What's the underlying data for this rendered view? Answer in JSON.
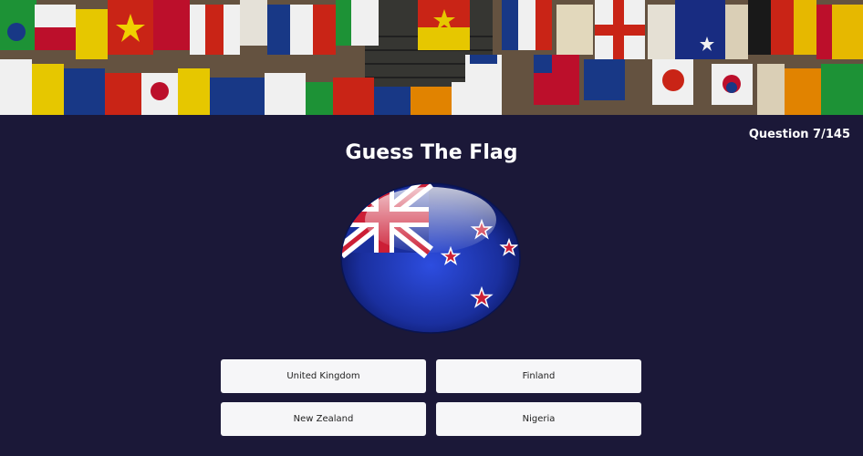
{
  "header": {
    "banner_icon": "world-flags-banner-image",
    "question_counter": "Question 7/145"
  },
  "main": {
    "title": "Guess The Flag",
    "flag_icon": "new-zealand-flag-globe-icon",
    "answers": [
      "United Kingdom",
      "Finland",
      "New Zealand",
      "Nigeria"
    ]
  },
  "colors": {
    "background": "#1b1838",
    "button_bg": "#f6f6f8",
    "flag_blue": "#1a2f9e",
    "flag_red": "#cc1f36"
  }
}
